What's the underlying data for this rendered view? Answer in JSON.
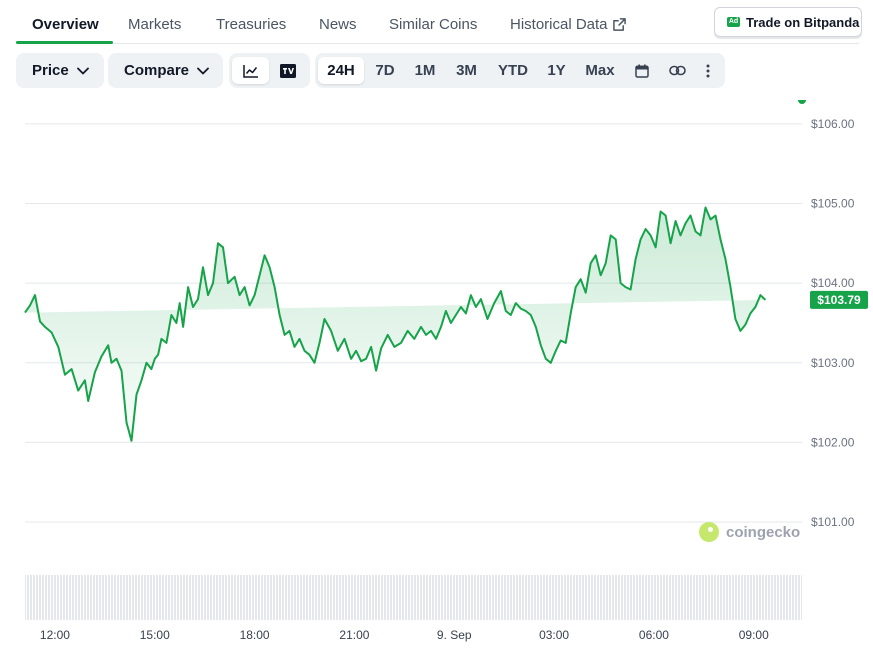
{
  "tabs": [
    {
      "label": "Overview"
    },
    {
      "label": "Markets"
    },
    {
      "label": "Treasuries"
    },
    {
      "label": "News"
    },
    {
      "label": "Similar Coins"
    },
    {
      "label": "Historical Data"
    }
  ],
  "ad": {
    "badge": "Ad",
    "label": "Trade on Bitpanda"
  },
  "toolbar": {
    "price_label": "Price",
    "compare_label": "Compare",
    "chart_mode_icons": [
      "line-chart-icon",
      "tradingview-icon"
    ],
    "timeframes": [
      "24H",
      "7D",
      "1M",
      "3M",
      "YTD",
      "1Y",
      "Max"
    ],
    "selected_timeframe": "24H",
    "extra_icons": [
      "calendar-icon",
      "link-icon",
      "more-icon"
    ]
  },
  "watermark": "coingecko",
  "colors": {
    "accent": "#16a34a",
    "line": "#16a34a",
    "grid": "#e5e7eb"
  },
  "chart_data": {
    "type": "area",
    "ylim": [
      100.9,
      106.3
    ],
    "ytick_labels": [
      "$106.00",
      "$105.00",
      "$104.00",
      "$103.00",
      "$102.00",
      "$101.00"
    ],
    "ytick_values": [
      106,
      105,
      104,
      103,
      102,
      101
    ],
    "xtick_labels": [
      "12:00",
      "15:00",
      "18:00",
      "21:00",
      "9. Sep",
      "03:00",
      "06:00",
      "09:00"
    ],
    "xtick_hours": [
      12,
      15,
      18,
      21,
      24,
      27,
      30,
      33
    ],
    "x_hours": [
      11.1,
      11.25,
      11.4,
      11.55,
      11.7,
      11.9,
      12.1,
      12.3,
      12.5,
      12.7,
      12.9,
      13.0,
      13.2,
      13.4,
      13.5,
      13.6,
      13.7,
      13.85,
      14.0,
      14.15,
      14.3,
      14.45,
      14.6,
      14.75,
      14.9,
      15.0,
      15.1,
      15.2,
      15.35,
      15.5,
      15.65,
      15.75,
      15.85,
      16.0,
      16.15,
      16.3,
      16.45,
      16.6,
      16.75,
      16.9,
      17.05,
      17.2,
      17.4,
      17.55,
      17.7,
      17.85,
      18.0,
      18.15,
      18.3,
      18.45,
      18.6,
      18.75,
      18.9,
      19.05,
      19.2,
      19.35,
      19.5,
      19.65,
      19.8,
      19.95,
      20.1,
      20.3,
      20.5,
      20.7,
      20.9,
      21.05,
      21.2,
      21.35,
      21.5,
      21.65,
      21.8,
      22.0,
      22.2,
      22.4,
      22.6,
      22.8,
      23.0,
      23.15,
      23.3,
      23.45,
      23.6,
      23.75,
      23.9,
      24.05,
      24.2,
      24.35,
      24.5,
      24.65,
      24.8,
      25.0,
      25.2,
      25.4,
      25.55,
      25.7,
      25.85,
      26.0,
      26.15,
      26.3,
      26.45,
      26.6,
      26.75,
      26.9,
      27.05,
      27.2,
      27.35,
      27.5,
      27.65,
      27.8,
      27.95,
      28.1,
      28.25,
      28.4,
      28.55,
      28.7,
      28.85,
      29.0,
      29.15,
      29.3,
      29.45,
      29.6,
      29.75,
      29.9,
      30.05,
      30.2,
      30.35,
      30.5,
      30.65,
      30.8,
      30.95,
      31.1,
      31.25,
      31.4,
      31.55,
      31.7,
      31.85,
      32.0,
      32.15,
      32.3,
      32.45,
      32.6,
      32.75,
      32.9,
      33.05,
      33.2,
      33.35,
      33.5,
      33.65,
      33.8,
      33.95,
      34.05,
      34.15,
      34.25,
      34.35,
      34.45
    ],
    "series": [
      {
        "values": [
          103.63,
          103.72,
          103.85,
          103.52,
          103.45,
          103.38,
          103.2,
          102.85,
          102.92,
          102.65,
          102.78,
          102.52,
          102.88,
          103.08,
          103.15,
          103.22,
          103.0,
          103.05,
          102.9,
          102.25,
          102.02,
          102.6,
          102.78,
          103.0,
          102.92,
          103.05,
          103.1,
          103.3,
          103.25,
          103.6,
          103.5,
          103.75,
          103.45,
          103.95,
          103.7,
          103.8,
          104.2,
          103.85,
          104.0,
          104.5,
          104.45,
          104.0,
          104.08,
          103.85,
          103.95,
          103.72,
          103.85,
          104.1,
          104.35,
          104.2,
          103.95,
          103.6,
          103.35,
          103.4,
          103.2,
          103.3,
          103.15,
          103.1,
          103.0,
          103.25,
          103.55,
          103.4,
          103.15,
          103.3,
          103.05,
          103.15,
          103.02,
          103.05,
          103.2,
          102.9,
          103.18,
          103.35,
          103.2,
          103.25,
          103.4,
          103.3,
          103.45,
          103.35,
          103.4,
          103.3,
          103.45,
          103.65,
          103.5,
          103.6,
          103.7,
          103.62,
          103.85,
          103.7,
          103.8,
          103.55,
          103.75,
          103.9,
          103.65,
          103.6,
          103.75,
          103.68,
          103.65,
          103.6,
          103.45,
          103.22,
          103.05,
          103.0,
          103.15,
          103.28,
          103.25,
          103.62,
          103.95,
          104.05,
          103.88,
          104.25,
          104.35,
          104.1,
          104.25,
          104.6,
          104.55,
          104.0,
          103.95,
          103.92,
          104.3,
          104.55,
          104.68,
          104.6,
          104.45,
          104.9,
          104.85,
          104.5,
          104.78,
          104.6,
          104.75,
          104.85,
          104.65,
          104.6,
          104.95,
          104.8,
          104.85,
          104.55,
          104.3,
          103.95,
          103.55,
          103.4,
          103.48,
          103.62,
          103.7,
          103.85,
          103.79
        ]
      }
    ],
    "current_price_label": "$103.79",
    "volume_note": ""
  }
}
